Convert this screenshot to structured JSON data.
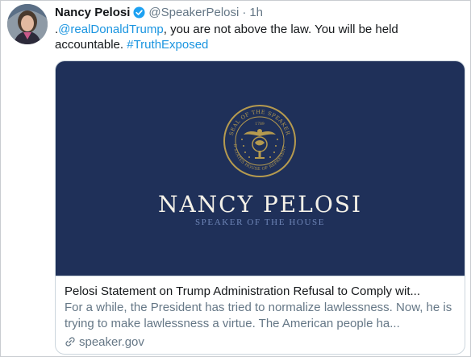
{
  "tweet": {
    "author_name": "Nancy Pelosi",
    "handle": "@SpeakerPelosi",
    "separator": "·",
    "time": "1h",
    "text_prefix": ".",
    "mention": "@realDonaldTrump",
    "text_body": ", you are not above the law. You will be held accountable. ",
    "hashtag": "#TruthExposed"
  },
  "card": {
    "image": {
      "seal_text_top": "SEAL OF THE SPEAKER",
      "seal_text_bottom": "UNITED STATES HOUSE OF REPRESENTATIVES",
      "seal_year": "1789",
      "name": "NANCY PELOSI",
      "subtitle": "SPEAKER OF THE HOUSE"
    },
    "title": "Pelosi Statement on Trump Administration Refusal to Comply wit...",
    "description": "For a while, the President has tried to normalize lawlessness. Now, he is trying to make lawlessness a virtue. The American people ha...",
    "domain": "speaker.gov"
  },
  "icons": {
    "verified": "verified-badge-icon",
    "link": "link-icon"
  },
  "colors": {
    "link": "#1b95e0",
    "secondary_text": "#657786",
    "card_navy": "#1f3059",
    "seal_gold": "#b59a4f"
  }
}
